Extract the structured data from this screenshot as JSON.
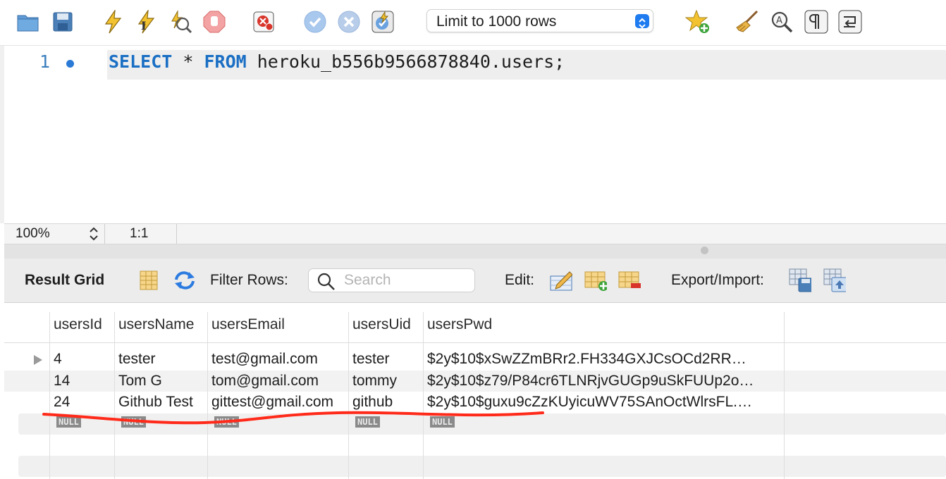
{
  "toolbar": {
    "limit_select": "Limit to 1000 rows",
    "icons": [
      "open-folder-icon",
      "save-icon",
      "execute-icon",
      "execute-current-icon",
      "explain-icon",
      "stop-icon",
      "toggle-error-icon",
      "commit-icon",
      "rollback-icon",
      "autocommit-icon",
      "bookmark-icon",
      "beautify-icon",
      "find-icon",
      "invisibles-icon",
      "wrap-icon"
    ]
  },
  "editor": {
    "line_number": "1",
    "kw_select": "SELECT",
    "star": " * ",
    "kw_from": "FROM",
    "rest": " heroku_b556b9566878840.users;"
  },
  "statusbar": {
    "zoom": "100%",
    "cursor": "1:1"
  },
  "result_toolbar": {
    "title": "Result Grid",
    "filter_label": "Filter Rows:",
    "search_placeholder": "Search",
    "edit_label": "Edit:",
    "export_label": "Export/Import:"
  },
  "grid": {
    "columns": [
      "usersId",
      "usersName",
      "usersEmail",
      "usersUid",
      "usersPwd"
    ],
    "rows": [
      [
        "4",
        "tester",
        "test@gmail.com",
        "tester",
        "$2y$10$xSwZZmBRr2.FH334GXJCsOCd2RR…"
      ],
      [
        "14",
        "Tom G",
        "tom@gmail.com",
        "tommy",
        "$2y$10$z79/P84cr6TLNRjvGUGp9uSkFUUp2o…"
      ],
      [
        "24",
        "Github Test",
        "gittest@gmail.com",
        "github",
        "$2y$10$guxu9cZzKUyicuWV75SAnOctWlrsFL.…"
      ]
    ],
    "null_label": "NULL"
  },
  "colors": {
    "accent": "#1f7cf0",
    "keyword": "#1a6fc4",
    "annotation": "#ff2a1a"
  }
}
